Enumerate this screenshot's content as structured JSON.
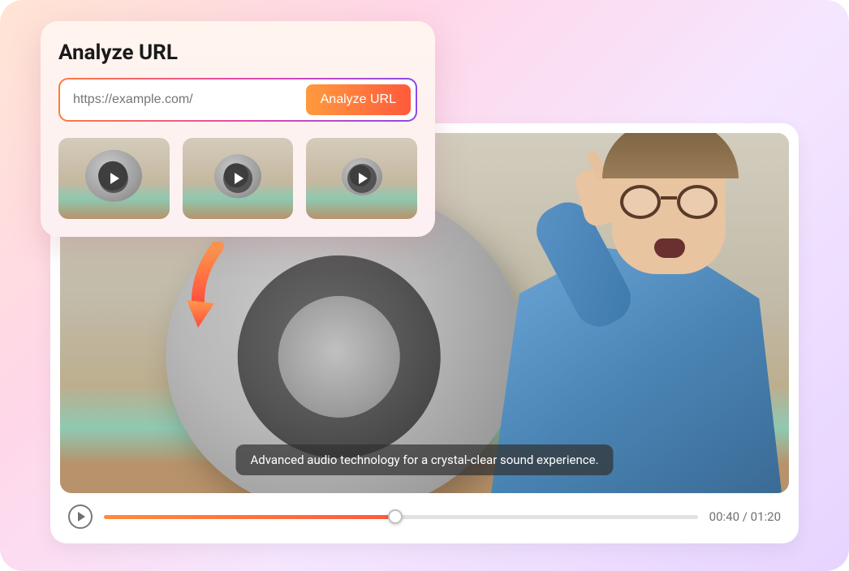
{
  "overlay": {
    "title": "Analyze URL",
    "url_placeholder": "https://example.com/",
    "analyze_button": "Analyze URL"
  },
  "video": {
    "caption": "Advanced audio technology for a crystal-clear sound experience.",
    "current_time": "00:40",
    "total_time": "01:20",
    "progress_percent": 49
  },
  "colors": {
    "gradient_start": "#ff9a3d",
    "gradient_end": "#ff5a3d",
    "accent_purple": "#8a4ae8"
  }
}
